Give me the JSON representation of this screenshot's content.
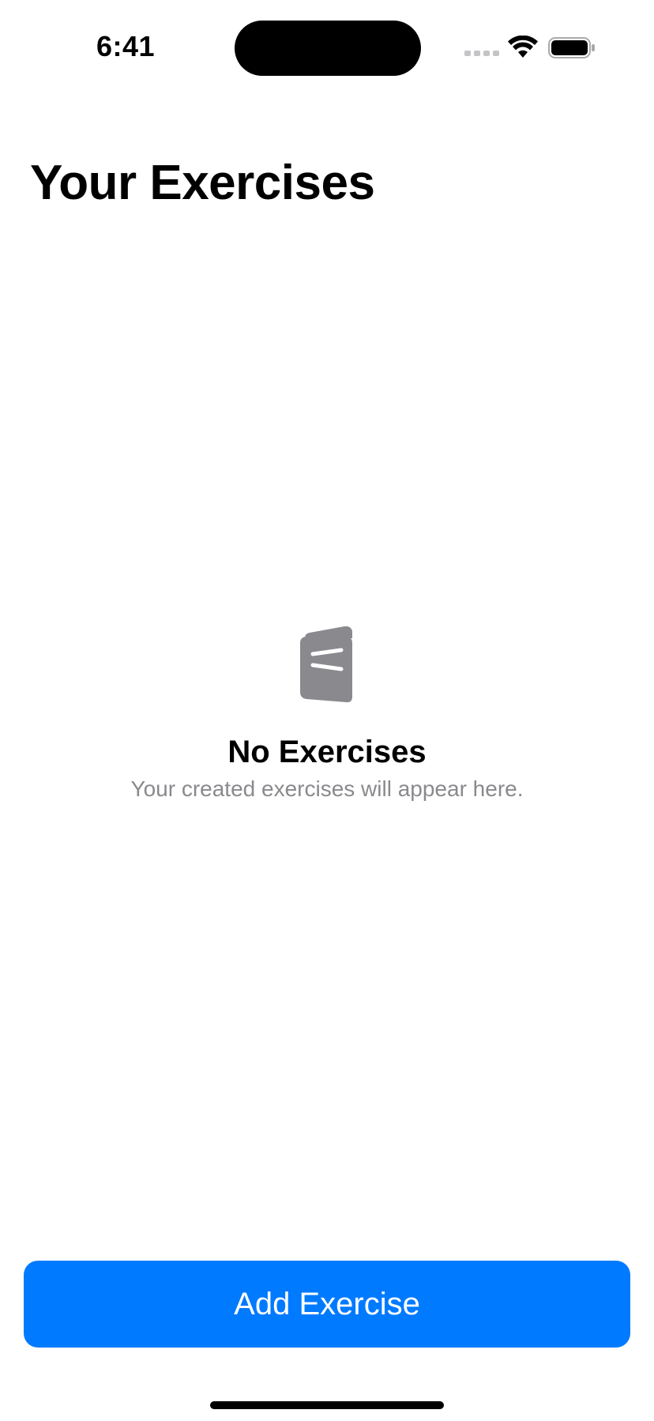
{
  "status_bar": {
    "time": "6:41",
    "icons": [
      "cellular-signal-icon",
      "wifi-icon",
      "battery-icon"
    ]
  },
  "header": {
    "title": "Your Exercises"
  },
  "empty_state": {
    "icon": "book-icon",
    "title": "No Exercises",
    "subtitle": "Your created exercises will appear here."
  },
  "actions": {
    "add_label": "Add Exercise"
  },
  "colors": {
    "accent": "#007aff",
    "icon_gray": "#8a8a8e",
    "secondary_text": "#8a8a8e"
  }
}
